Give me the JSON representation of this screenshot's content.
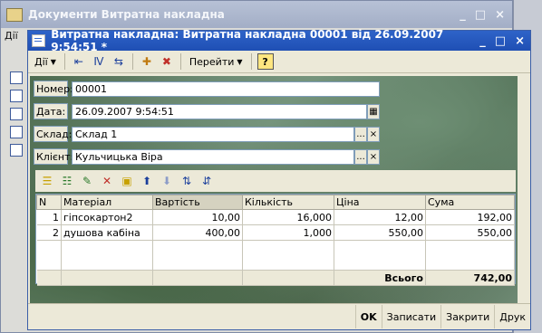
{
  "bg_window": {
    "title": "Документи Витратна накладна",
    "menu_label": "Дії"
  },
  "window": {
    "title": "Витратна накладна: Витратна накладна 00001 від 26.09.2007 9:54:51 *",
    "minimize": "_",
    "maximize": "□",
    "close": "×"
  },
  "toolbar": {
    "actions_menu": "Дії",
    "goto_menu": "Перейти",
    "help": "?"
  },
  "form": {
    "number_label": "Номер:",
    "number_value": "00001",
    "date_label": "Дата:",
    "date_value": "26.09.2007  9:54:51",
    "warehouse_label": "Склад:",
    "warehouse_value": "Склад 1",
    "client_label": "Клієнт:",
    "client_value": "Кульчицька Віра",
    "select_symbol": "...",
    "clear_symbol": "×"
  },
  "table": {
    "columns": [
      "N",
      "Матеріал",
      "Вартість",
      "Кількість",
      "Ціна",
      "Сума"
    ],
    "rows": [
      [
        "1",
        "гіпсокартон2",
        "10,00",
        "16,000",
        "12,00",
        "192,00"
      ],
      [
        "2",
        "душова кабіна",
        "400,00",
        "1,000",
        "550,00",
        "550,00"
      ]
    ],
    "total_label": "Всього",
    "total_value": "742,00"
  },
  "buttons": {
    "ok": "OK",
    "save": "Записати",
    "close": "Закрити",
    "print": "Друк"
  }
}
